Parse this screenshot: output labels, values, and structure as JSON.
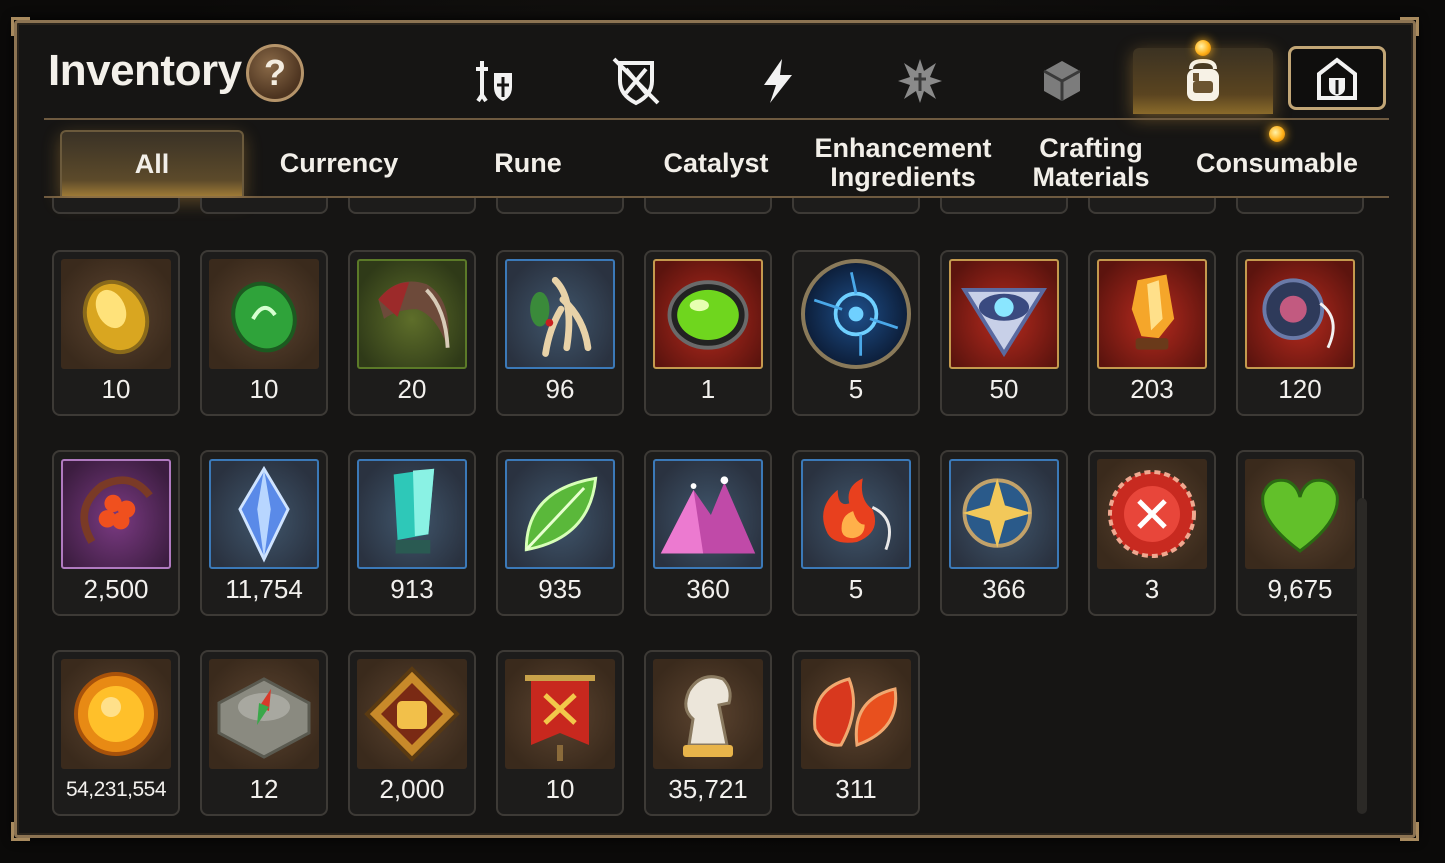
{
  "header": {
    "title": "Inventory",
    "help_label": "?"
  },
  "category_tabs": [
    {
      "icon": "hero-gear-icon",
      "active": false
    },
    {
      "icon": "no-shield-icon",
      "active": false
    },
    {
      "icon": "lightning-icon",
      "active": false
    },
    {
      "icon": "rune-burst-icon",
      "active": false
    },
    {
      "icon": "cube-icon",
      "active": false
    },
    {
      "icon": "backpack-icon",
      "active": true
    },
    {
      "icon": "guild-helmet-icon",
      "active": false
    }
  ],
  "filters": [
    {
      "label": "All",
      "active": true
    },
    {
      "label": "Currency",
      "active": false
    },
    {
      "label": "Rune",
      "active": false
    },
    {
      "label": "Catalyst",
      "active": false
    },
    {
      "label": "Enhancement Ingredients",
      "active": false
    },
    {
      "label": "Crafting Materials",
      "active": false
    },
    {
      "label": "Consumable",
      "active": false
    }
  ],
  "items": {
    "row1": [
      {
        "icon": "yellow-gem-icon",
        "qty": "10"
      },
      {
        "icon": "green-gem-icon",
        "qty": "10"
      },
      {
        "icon": "claw-icon",
        "qty": "20"
      },
      {
        "icon": "root-herb-icon",
        "qty": "96"
      },
      {
        "icon": "green-orb-icon",
        "qty": "1"
      },
      {
        "icon": "blue-rune-disc-icon",
        "qty": "5"
      },
      {
        "icon": "eye-emblem-icon",
        "qty": "50"
      },
      {
        "icon": "fire-crystal-icon",
        "qty": "203"
      },
      {
        "icon": "ring-pendant-icon",
        "qty": "120"
      }
    ],
    "row2": [
      {
        "icon": "red-flower-ring-icon",
        "qty": "2,500"
      },
      {
        "icon": "blue-crystal-icon",
        "qty": "11,754"
      },
      {
        "icon": "teal-crystal-icon",
        "qty": "913"
      },
      {
        "icon": "green-leaf-icon",
        "qty": "935"
      },
      {
        "icon": "pink-mountain-icon",
        "qty": "360"
      },
      {
        "icon": "fire-pendant-icon",
        "qty": "5"
      },
      {
        "icon": "star-amulet-icon",
        "qty": "366"
      },
      {
        "icon": "red-seal-icon",
        "qty": "3"
      },
      {
        "icon": "green-heart-icon",
        "qty": "9,675"
      }
    ],
    "row3": [
      {
        "icon": "gold-coin-icon",
        "qty": "54,231,554"
      },
      {
        "icon": "stone-compass-icon",
        "qty": "12"
      },
      {
        "icon": "fist-emblem-icon",
        "qty": "2,000"
      },
      {
        "icon": "battle-banner-icon",
        "qty": "10"
      },
      {
        "icon": "chess-knight-icon",
        "qty": "35,721"
      },
      {
        "icon": "red-leaves-icon",
        "qty": "311"
      }
    ]
  },
  "colors": {
    "frame": "#8c7352",
    "active_glow": "#ffb21a",
    "slot_bg": "#1d1c1b"
  }
}
